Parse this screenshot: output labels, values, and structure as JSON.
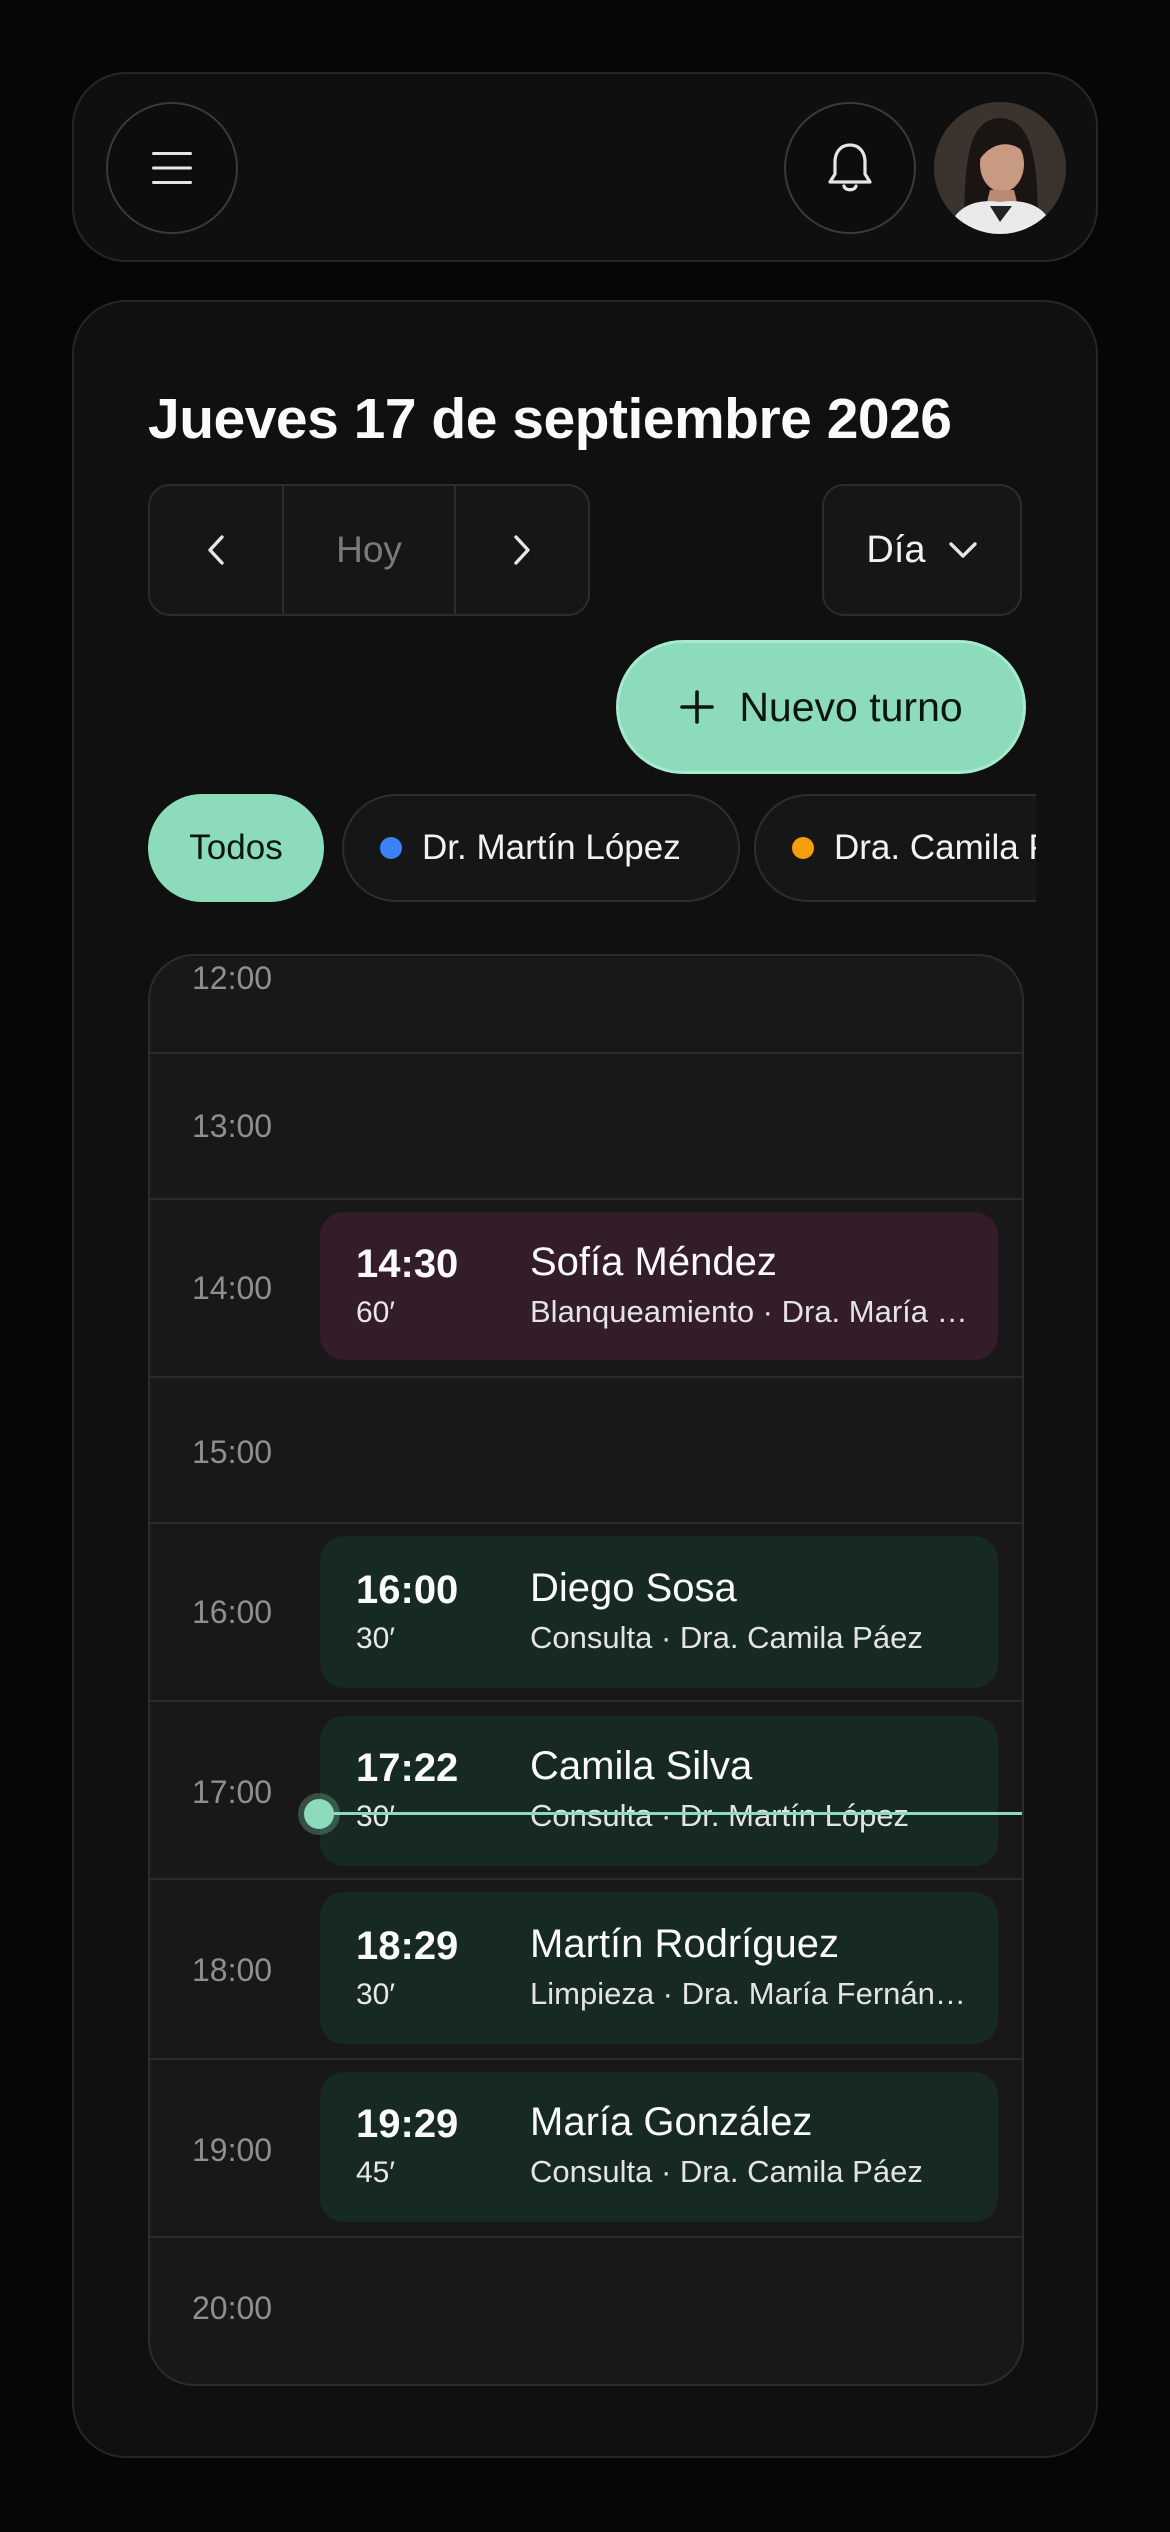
{
  "header": {
    "menu_icon": "hamburger-menu-icon",
    "bell_icon": "bell-icon",
    "avatar": "user-avatar"
  },
  "calendar": {
    "date_title": "Jueves 17 de septiembre 2026",
    "today_label": "Hoy",
    "view_label": "Día",
    "new_button_label": "Nuevo turno",
    "filters": [
      {
        "label": "Todos",
        "active": true
      },
      {
        "label": "Dr. Martín López",
        "color": "#3b82f6"
      },
      {
        "label": "Dra. Camila Páez",
        "color": "#f59e0b"
      }
    ],
    "hours": [
      "12:00",
      "13:00",
      "14:00",
      "15:00",
      "16:00",
      "17:00",
      "18:00",
      "19:00",
      "20:00"
    ],
    "appointments": [
      {
        "time": "14:30",
        "duration": "60′",
        "patient": "Sofía Méndez",
        "detail": "Blanqueamiento · Dra. María Fernández",
        "color": "#331d2b"
      },
      {
        "time": "16:00",
        "duration": "30′",
        "patient": "Diego Sosa",
        "detail": "Consulta · Dra. Camila Páez",
        "color": "#162922"
      },
      {
        "time": "17:22",
        "duration": "30′",
        "patient": "Camila Silva",
        "detail": "Consulta · Dr. Martín López",
        "color": "#162922"
      },
      {
        "time": "18:29",
        "duration": "30′",
        "patient": "Martín Rodríguez",
        "detail": "Limpieza · Dra. María Fernández",
        "color": "#162922"
      },
      {
        "time": "19:29",
        "duration": "45′",
        "patient": "María González",
        "detail": "Consulta · Dra. Camila Páez",
        "color": "#162922"
      }
    ],
    "accent_color": "#8cdcbc"
  }
}
